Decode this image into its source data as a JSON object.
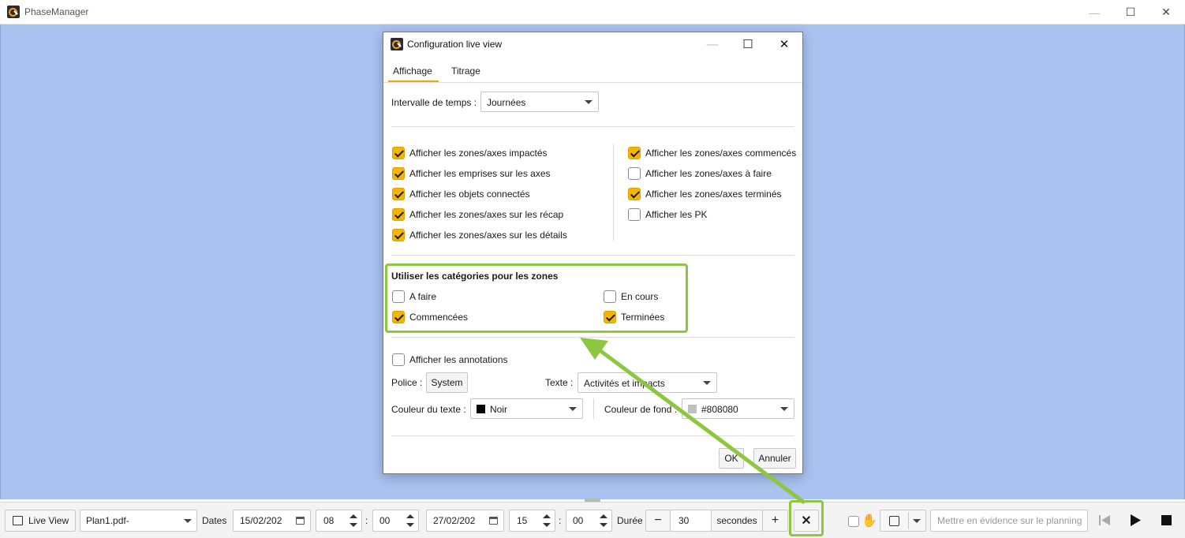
{
  "app": {
    "title": "PhaseManager"
  },
  "dialog": {
    "title": "Configuration live view",
    "tabs": [
      "Affichage",
      "Titrage"
    ],
    "interval": {
      "label": "Intervalle de temps :",
      "value": "Journées"
    },
    "left_options": [
      {
        "label": "Afficher les zones/axes impactés",
        "checked": true
      },
      {
        "label": "Afficher les emprises sur les axes",
        "checked": true
      },
      {
        "label": "Afficher les objets connectés",
        "checked": true
      },
      {
        "label": "Afficher les zones/axes sur les récap",
        "checked": true
      },
      {
        "label": "Afficher les zones/axes sur les détails",
        "checked": true
      }
    ],
    "right_options": [
      {
        "label": "Afficher les zones/axes commencés",
        "checked": true
      },
      {
        "label": "Afficher les zones/axes à faire",
        "checked": false
      },
      {
        "label": "Afficher les zones/axes terminés",
        "checked": true
      },
      {
        "label": "Afficher les PK",
        "checked": false
      }
    ],
    "categories": {
      "heading": "Utiliser les catégories pour les zones",
      "a_faire": {
        "label": "A faire",
        "checked": false
      },
      "en_cours": {
        "label": "En cours",
        "checked": false
      },
      "commencees": {
        "label": "Commencées",
        "checked": true
      },
      "terminees": {
        "label": "Terminées",
        "checked": true
      }
    },
    "annotations": {
      "show": {
        "label": "Afficher les annotations",
        "checked": false
      },
      "font_label": "Police :",
      "font_value": "System",
      "text_label": "Texte :",
      "text_value": "Activités et impacts",
      "text_color_label": "Couleur du texte :",
      "text_color_value": "Noir",
      "text_color_swatch": "#000000",
      "bg_color_label": "Couleur de fond :",
      "bg_color_value": "#808080",
      "bg_color_swatch": "#c0c0c0"
    },
    "ok_label": "OK",
    "cancel_label": "Annuler"
  },
  "toolbar": {
    "live_view_label": "Live View",
    "plan_value": "Plan1.pdf-",
    "dates_label": "Dates",
    "start_date": "15/02/202",
    "start_hour": "08",
    "start_minute": "00",
    "time_sep": ":",
    "end_date": "27/02/202",
    "end_hour": "15",
    "end_minute": "00",
    "duration_label": "Durée",
    "minus_label": "−",
    "duration_value": "30",
    "duration_unit": "secondes",
    "plus_label": "+",
    "highlight_placeholder": "Mettre en évidence sur le planning"
  },
  "colors": {
    "workspace": "#a9c2f0",
    "accent": "#f5b400",
    "annotation": "#8dc63f"
  }
}
